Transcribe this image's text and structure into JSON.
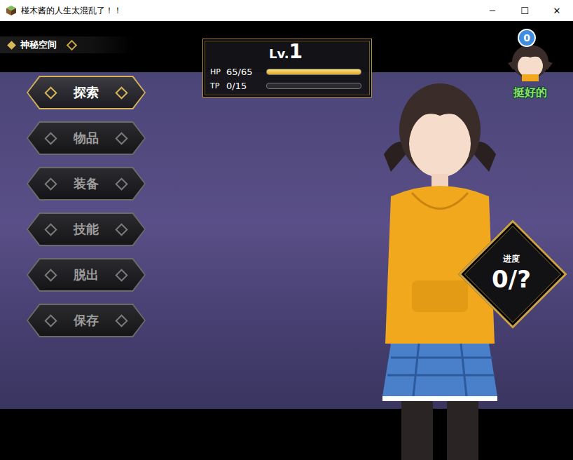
{
  "window": {
    "title": "椪木酱的人生太混乱了！！",
    "controls": [
      "─",
      "☐",
      "✕"
    ]
  },
  "location": {
    "label": "神秘空间"
  },
  "status": {
    "level_label": "Lv.",
    "level": "1",
    "bars": [
      {
        "label": "HP",
        "reading": "65/65",
        "level": 1
      },
      {
        "label": "TP",
        "reading": "0/15",
        "level": 0
      }
    ]
  },
  "menu": [
    {
      "label": "探索",
      "selected": true
    },
    {
      "label": "物品",
      "selected": false
    },
    {
      "label": "装备",
      "selected": false
    },
    {
      "label": "技能",
      "selected": false
    },
    {
      "label": "脱出",
      "selected": false
    },
    {
      "label": "保存",
      "selected": false
    }
  ],
  "mood": {
    "count": "0",
    "text": "挺好的"
  },
  "progress": {
    "label": "进度",
    "value": "0/?"
  }
}
